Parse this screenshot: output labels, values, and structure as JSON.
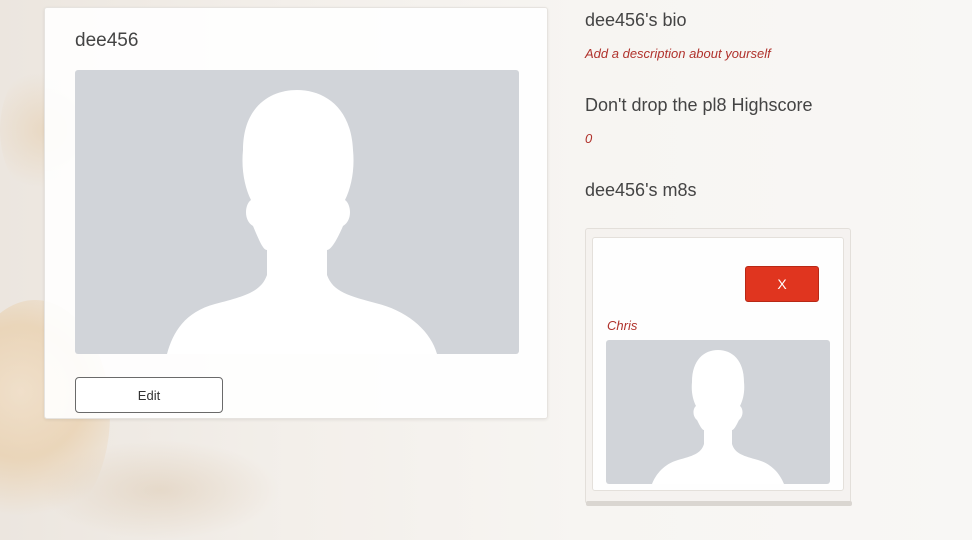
{
  "profile": {
    "username": "dee456",
    "avatar_icon": "person-silhouette-icon",
    "edit_label": "Edit"
  },
  "bio": {
    "heading": "dee456's bio",
    "placeholder_text": "Add a description about yourself"
  },
  "highscore": {
    "heading": "Don't drop the pl8 Highscore",
    "value": "0"
  },
  "mates": {
    "heading": "dee456's m8s",
    "items": [
      {
        "name": "Chris",
        "remove_label": "X",
        "avatar_icon": "person-silhouette-icon"
      }
    ]
  },
  "colors": {
    "accent_red": "#e0351f",
    "link_red": "#b0322c",
    "avatar_bg": "#d1d4d9"
  }
}
